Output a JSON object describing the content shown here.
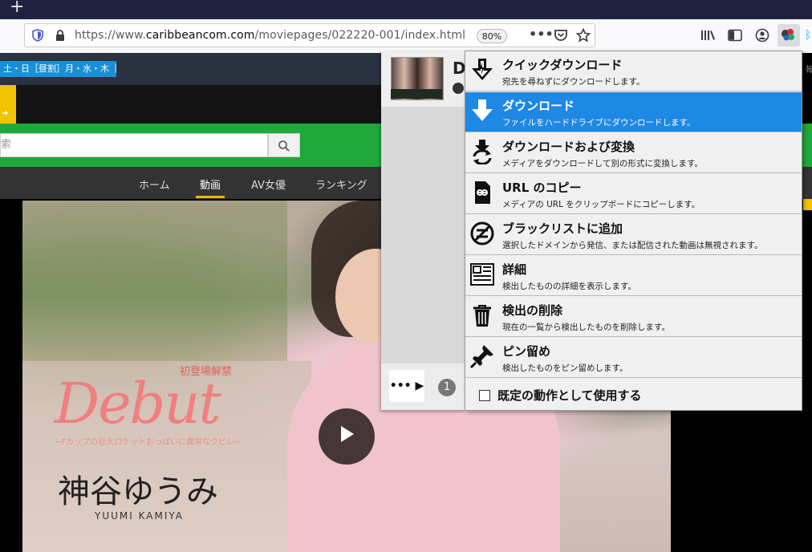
{
  "browser": {
    "new_tab_glyph": "+",
    "url_scheme": "https://www.",
    "url_host": "caribbeancom.com",
    "url_path": "/moviepages/022220-001/index.html",
    "zoom": "80%",
    "page_actions_glyph": "•••"
  },
  "site": {
    "schedule": "土・日［昼割］月・水・木［夜割］",
    "search_placeholder": "索",
    "nav": [
      "ホーム",
      "動画",
      "AV女優",
      "ランキング"
    ],
    "hero": {
      "tag": "初登場解禁",
      "title": "Debut",
      "subtitle": "~Fカップの巨大ロケットおっぱいに異常なクビレ~",
      "actress": "神谷ゆうみ",
      "actress_en": "YUUMI KAMIYA"
    },
    "edge_char": "報"
  },
  "extension": {
    "item_title_initial": "D",
    "more_label": "•••",
    "count": "1"
  },
  "menu": {
    "items": [
      {
        "title": "クイックダウンロード",
        "desc": "宛先を尋ねずにダウンロードします。",
        "icon": "quick-download-icon"
      },
      {
        "title": "ダウンロード",
        "desc": "ファイルをハードドライブにダウンロードします。",
        "icon": "download-icon",
        "selected": true
      },
      {
        "title": "ダウンロードおよび変換",
        "desc": "メディアをダウンロードして別の形式に変換します。",
        "icon": "download-convert-icon"
      },
      {
        "title": "URL のコピー",
        "desc": "メディアの URL をクリップボードにコピーします。",
        "icon": "copy-url-icon"
      },
      {
        "title": "ブラックリストに追加",
        "desc": "選択したドメインから発信、または配信された動画は無視されます。",
        "icon": "blacklist-icon"
      },
      {
        "title": "詳細",
        "desc": "検出したものの詳細を表示します。",
        "icon": "details-icon"
      },
      {
        "title": "検出の削除",
        "desc": "現在の一覧から検出したものを削除します。",
        "icon": "trash-icon"
      },
      {
        "title": "ピン留め",
        "desc": "検出したものをピン留めします。",
        "icon": "pin-icon"
      }
    ],
    "default_action": "既定の動作として使用する"
  },
  "colors": {
    "menu_selected": "#1e88e5",
    "site_green": "#1fa93a",
    "tab_strip": "#202340"
  }
}
